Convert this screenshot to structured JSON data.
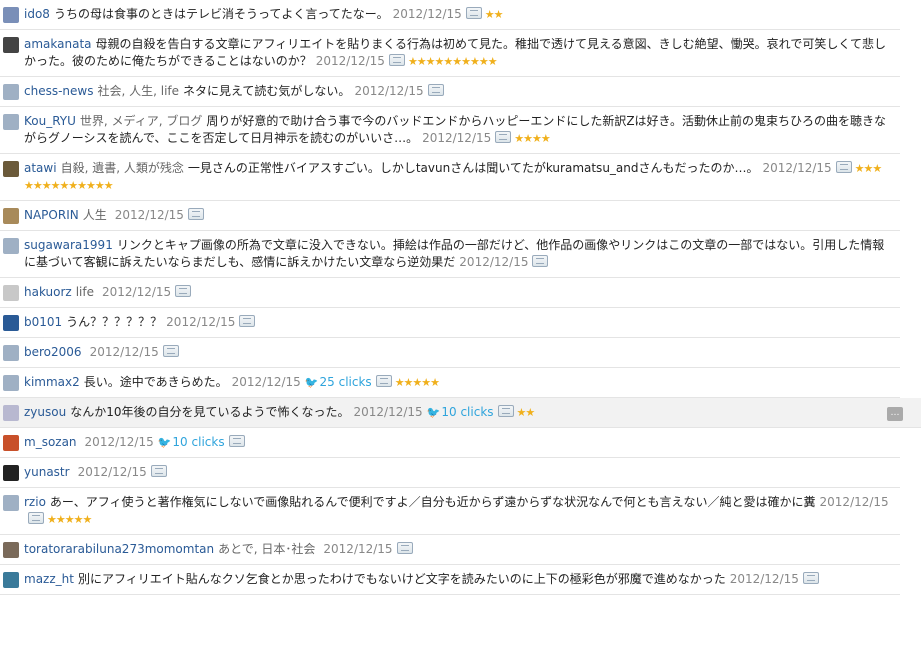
{
  "colors": {
    "link": "#2a5a96",
    "star": "#f0b01c",
    "twitter": "#2fa4dc"
  },
  "icons": {
    "add": "add-star-icon",
    "twitter": "twitter-bird-icon",
    "reply": "reply-icon",
    "star": "★"
  },
  "entries": [
    {
      "user": "ido8",
      "tags": "",
      "comment": "うちの母は食事のときはテレビ消そうってよく言ってたなー。",
      "date": "2012/12/15",
      "clicks": "",
      "stars": "★★",
      "avatar": "#7a8fb8"
    },
    {
      "user": "amakanata",
      "tags": "",
      "comment": "母親の自殺を告白する文章にアフィリエイトを貼りまくる行為は初めて見た。稚拙で透けて見える意図、きしむ絶望、慟哭。哀れで可笑しくて悲しかった。彼のために俺たちができることはないのか？",
      "date": "2012/12/15",
      "clicks": "",
      "stars": "★★★★★★★★★★",
      "avatar": "#444444"
    },
    {
      "user": "chess-news",
      "tags": "社会, 人生, life",
      "comment": "ネタに見えて読む気がしない。",
      "date": "2012/12/15",
      "clicks": "",
      "stars": "",
      "avatar": "#9fb0c4"
    },
    {
      "user": "Kou_RYU",
      "tags": "世界, メディア, ブログ",
      "comment": "周りが好意的で助け合う事で今のバッドエンドからハッピーエンドにした新訳Zは好き。活動休止前の鬼束ちひろの曲を聴きながらグノーシスを読んで、ここを否定して日月神示を読むのがいいさ…。",
      "date": "2012/12/15",
      "clicks": "",
      "stars": "★★★★",
      "avatar": "#9fb0c4"
    },
    {
      "user": "atawi",
      "tags": "自殺, 遺書, 人類が残念",
      "comment": "一見さんの正常性バイアスすごい。しかしtavunさんは聞いてたがkuramatsu_andさんもだったのか…。",
      "date": "2012/12/15",
      "clicks": "",
      "stars": "★★★ ★★★★★★★★★★",
      "avatar": "#6b5a3a"
    },
    {
      "user": "NAPORIN",
      "tags": "人生",
      "comment": "",
      "date": "2012/12/15",
      "clicks": "",
      "stars": "",
      "avatar": "#a88a5a"
    },
    {
      "user": "sugawara1991",
      "tags": "",
      "comment": "リンクとキャプ画像の所為で文章に没入できない。挿絵は作品の一部だけど、他作品の画像やリンクはこの文章の一部ではない。引用した情報に基づいて客観に訴えたいならまだしも、感情に訴えかけたい文章なら逆効果だ",
      "date": "2012/12/15",
      "clicks": "",
      "stars": "",
      "avatar": "#9fb0c4"
    },
    {
      "user": "hakuorz",
      "tags": "life",
      "comment": "",
      "date": "2012/12/15",
      "clicks": "",
      "stars": "",
      "avatar": "#c8c8c8"
    },
    {
      "user": "b0101",
      "tags": "",
      "comment": "うん？？？？？？",
      "date": "2012/12/15",
      "clicks": "",
      "stars": "",
      "avatar": "#2a5a96"
    },
    {
      "user": "bero2006",
      "tags": "",
      "comment": "",
      "date": "2012/12/15",
      "clicks": "",
      "stars": "",
      "avatar": "#9fb0c4"
    },
    {
      "user": "kimmax2",
      "tags": "",
      "comment": "長い。途中であきらめた。",
      "date": "2012/12/15",
      "clicks": "25 clicks",
      "stars": "★★★★★",
      "avatar": "#9fb0c4"
    },
    {
      "user": "zyusou",
      "tags": "",
      "comment": "なんか10年後の自分を見ているようで怖くなった。",
      "date": "2012/12/15",
      "clicks": "10 clicks",
      "stars": "★★",
      "avatar": "#b8b8d0",
      "highlight": true
    },
    {
      "user": "m_sozan",
      "tags": "",
      "comment": "",
      "date": "2012/12/15",
      "clicks": "10 clicks",
      "stars": "",
      "avatar": "#c8502a"
    },
    {
      "user": "yunastr",
      "tags": "",
      "comment": "",
      "date": "2012/12/15",
      "clicks": "",
      "stars": "",
      "avatar": "#222222"
    },
    {
      "user": "rzio",
      "tags": "",
      "comment": "あー、アフィ使うと著作権気にしないで画像貼れるんで便利ですよ／自分も近からず遠からずな状況なんで何とも言えない／純と愛は確かに糞",
      "date": "2012/12/15",
      "clicks": "",
      "stars": "★★★★★",
      "avatar": "#9fb0c4"
    },
    {
      "user": "toratorarabiluna273momomtan",
      "tags": "あとで, 日本･社会",
      "comment": "",
      "date": "2012/12/15",
      "clicks": "",
      "stars": "",
      "avatar": "#7a6a5a"
    },
    {
      "user": "mazz_ht",
      "tags": "",
      "comment": "別にアフィリエイト貼んなクソ乞食とか思ったわけでもないけど文字を読みたいのに上下の極彩色が邪魔で進めなかった",
      "date": "2012/12/15",
      "clicks": "",
      "stars": "",
      "avatar": "#3a7a9a"
    }
  ]
}
